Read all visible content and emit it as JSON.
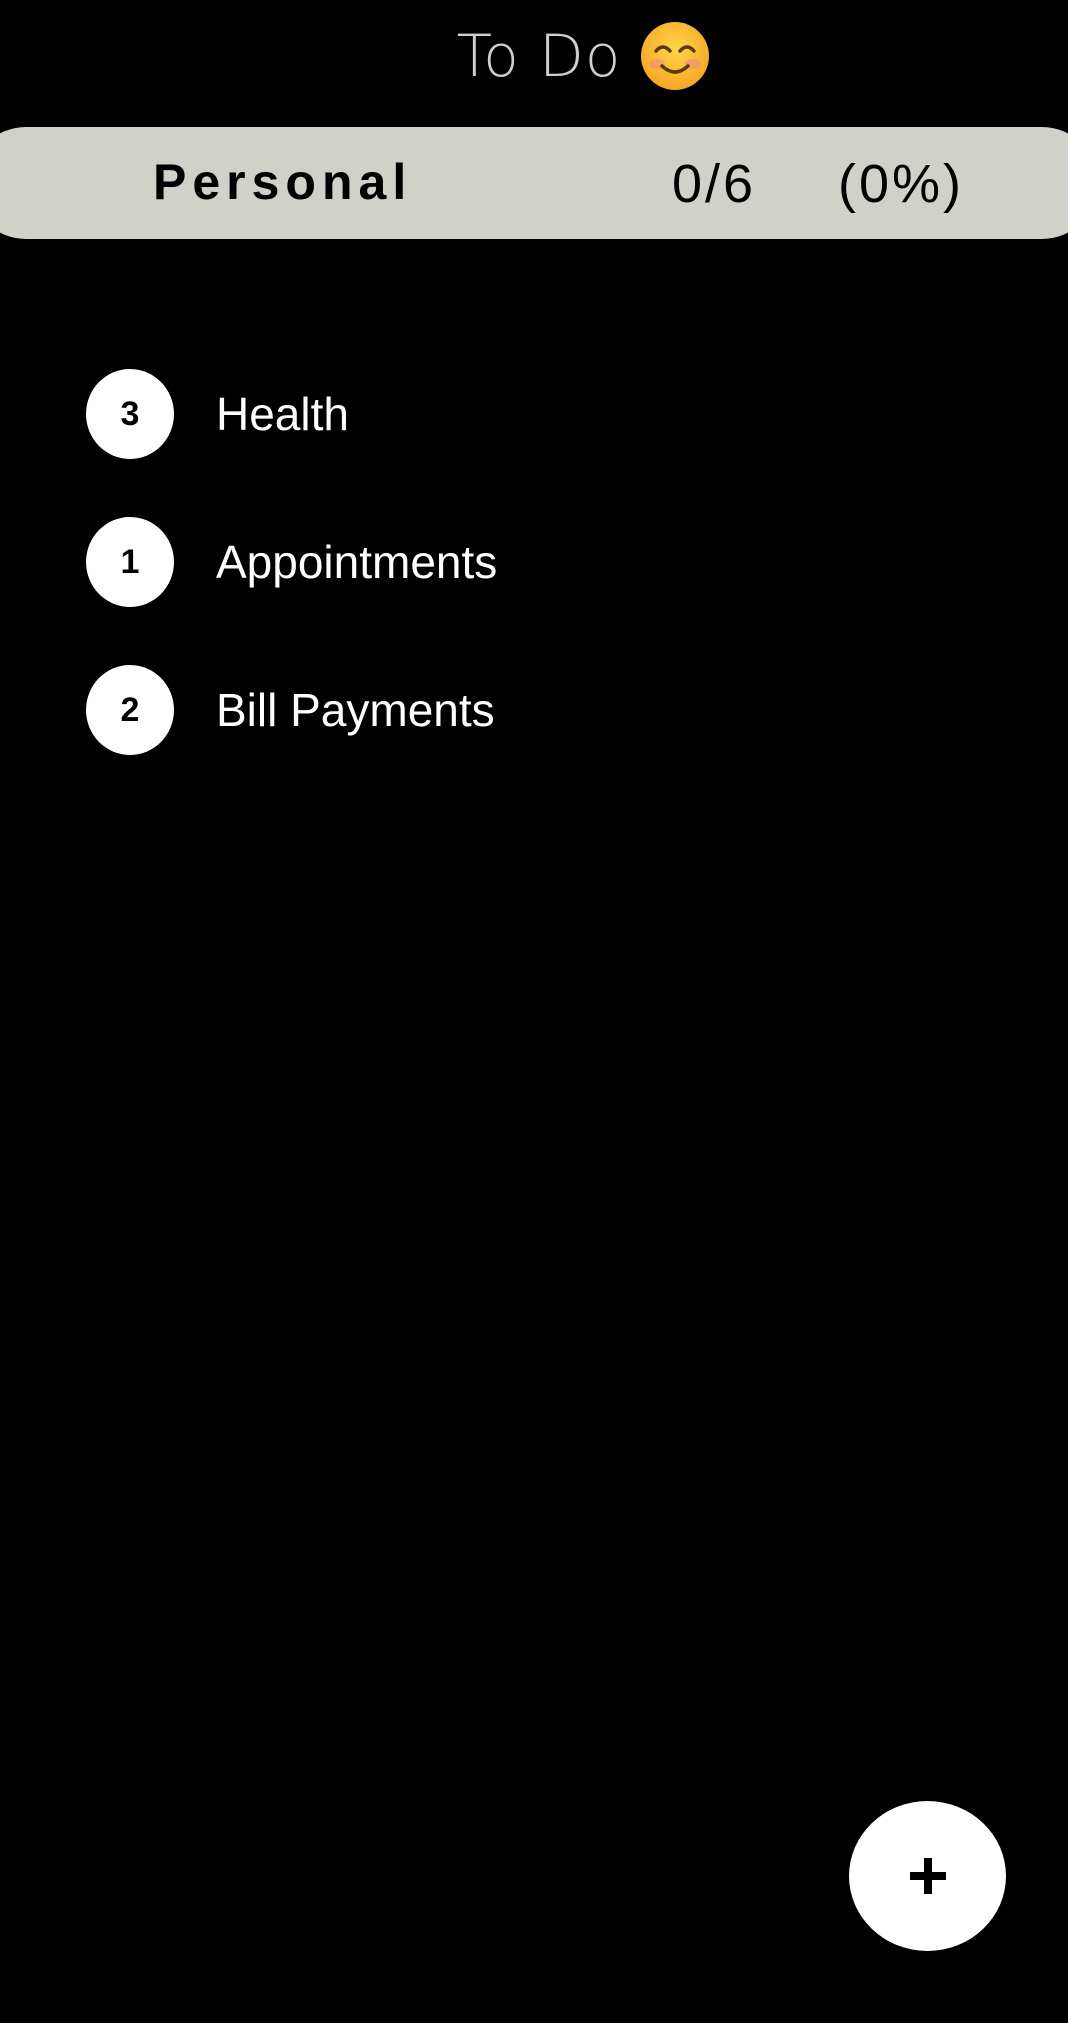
{
  "header": {
    "title": "To Do",
    "emoji_icon": "smiling-face-icon"
  },
  "category": {
    "name": "Personal",
    "count": "0/6",
    "percent": "(0%)",
    "background": "#d0d1c9"
  },
  "groups": [
    {
      "count": "3",
      "label": "Health"
    },
    {
      "count": "1",
      "label": "Appointments"
    },
    {
      "count": "2",
      "label": "Bill Payments"
    }
  ],
  "fab": {
    "icon": "plus-icon"
  },
  "colors": {
    "background": "#000000",
    "title_text": "#cfcfcf",
    "item_text": "#ffffff",
    "badge_bg": "#ffffff",
    "badge_text": "#000000"
  }
}
